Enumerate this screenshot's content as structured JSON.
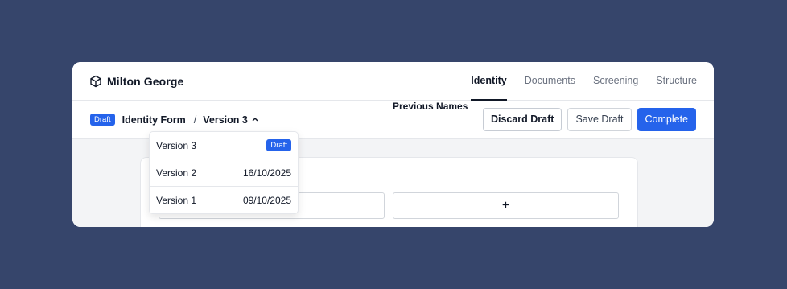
{
  "header": {
    "brand_icon": "cube-icon",
    "brand_name": "Milton George",
    "tabs": [
      {
        "label": "Identity",
        "active": true
      },
      {
        "label": "Documents",
        "active": false
      },
      {
        "label": "Screening",
        "active": false
      },
      {
        "label": "Structure",
        "active": false
      }
    ]
  },
  "breadcrumb": {
    "badge": "Draft",
    "title": "Identity Form",
    "separator": "/",
    "version": "Version 3",
    "toggle_icon": "chevron-up-icon"
  },
  "actions": {
    "discard": "Discard Draft",
    "save": "Save Draft",
    "complete": "Complete"
  },
  "versions_menu": [
    {
      "label": "Version 3",
      "badge": "Draft"
    },
    {
      "label": "Version 2",
      "date": "16/10/2025"
    },
    {
      "label": "Version 1",
      "date": "09/10/2025"
    }
  ],
  "form": {
    "previous_names_label": "Previous Names",
    "add_symbol": "+"
  },
  "colors": {
    "background": "#36456b",
    "accent": "#2563eb"
  }
}
